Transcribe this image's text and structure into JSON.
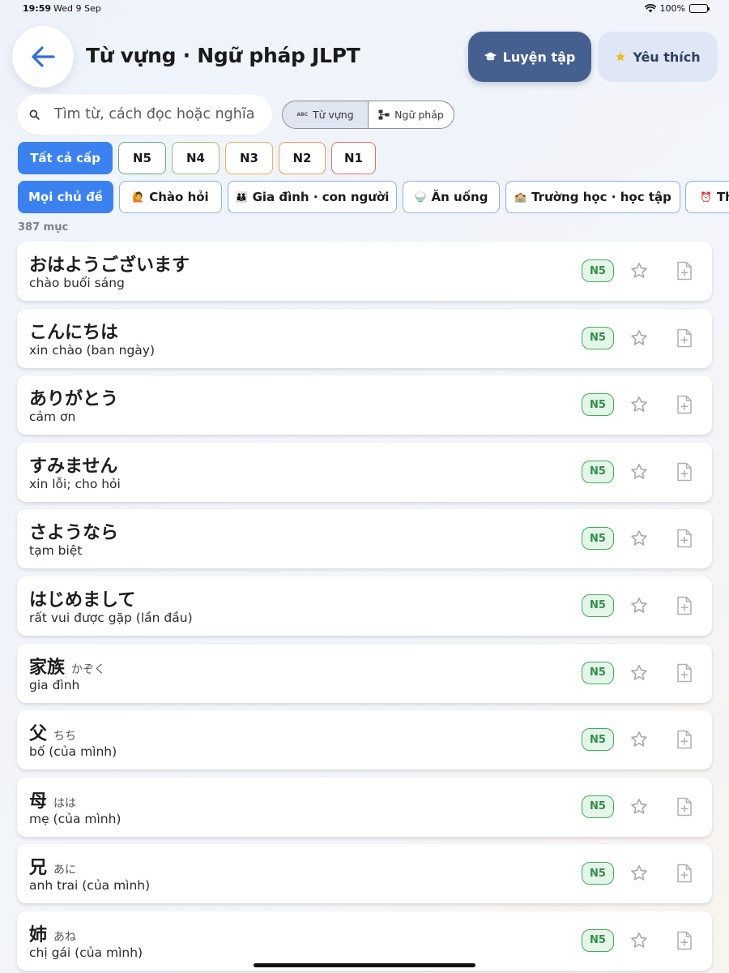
{
  "status": {
    "time": "19:59",
    "date": "Wed 9 Sep",
    "battery": "100%"
  },
  "header": {
    "title": "Từ vựng · Ngữ pháp JLPT",
    "practice_label": "Luyện tập",
    "favorites_label": "Yêu thích"
  },
  "search": {
    "placeholder": "Tìm từ, cách đọc hoặc nghĩa"
  },
  "segments": {
    "vocab": "Từ vựng",
    "grammar": "Ngữ pháp",
    "abc_badge": "ABC"
  },
  "levels": [
    "Tất cả cấp",
    "N5",
    "N4",
    "N3",
    "N2",
    "N1"
  ],
  "level_colors": {
    "N5": "#5fb57a",
    "N4": "#9bc46a",
    "N3": "#e8b45c",
    "N2": "#ef9a5a",
    "N1": "#e2706a"
  },
  "topics": [
    {
      "label": "Mọi chủ đề",
      "emoji": ""
    },
    {
      "label": "Chào hỏi",
      "emoji": "🙋"
    },
    {
      "label": "Gia đình · con người",
      "emoji": "👪"
    },
    {
      "label": "Ăn uống",
      "emoji": "🍚"
    },
    {
      "label": "Trường học · học tập",
      "emoji": "🏫"
    },
    {
      "label": "Th",
      "emoji": "⏰"
    }
  ],
  "count_label": "387 mục",
  "items": [
    {
      "jp": "おはようございます",
      "reading": "",
      "vi": "chào buổi sáng",
      "level": "N5"
    },
    {
      "jp": "こんにちは",
      "reading": "",
      "vi": "xin chào (ban ngày)",
      "level": "N5"
    },
    {
      "jp": "ありがとう",
      "reading": "",
      "vi": "cảm ơn",
      "level": "N5"
    },
    {
      "jp": "すみません",
      "reading": "",
      "vi": "xin lỗi; cho hỏi",
      "level": "N5"
    },
    {
      "jp": "さようなら",
      "reading": "",
      "vi": "tạm biệt",
      "level": "N5"
    },
    {
      "jp": "はじめまして",
      "reading": "",
      "vi": "rất vui được gặp (lần đầu)",
      "level": "N5"
    },
    {
      "jp": "家族",
      "reading": "かぞく",
      "vi": "gia đình",
      "level": "N5"
    },
    {
      "jp": "父",
      "reading": "ちち",
      "vi": "bố (của mình)",
      "level": "N5"
    },
    {
      "jp": "母",
      "reading": "はは",
      "vi": "mẹ (của mình)",
      "level": "N5"
    },
    {
      "jp": "兄",
      "reading": "あに",
      "vi": "anh trai (của mình)",
      "level": "N5"
    },
    {
      "jp": "姉",
      "reading": "あね",
      "vi": "chị gái (của mình)",
      "level": "N5"
    }
  ]
}
